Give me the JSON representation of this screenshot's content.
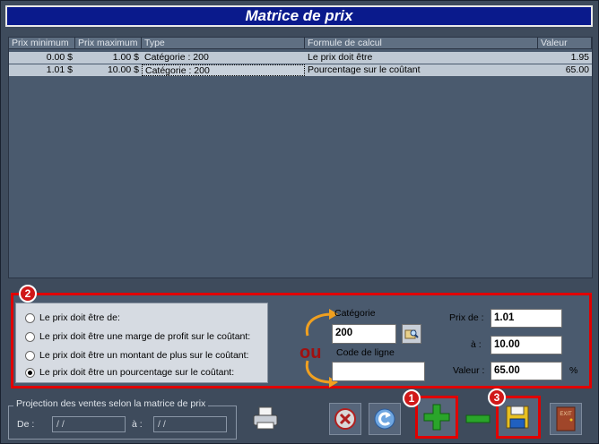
{
  "window": {
    "title": "Matrice de prix"
  },
  "table": {
    "columns": [
      "Prix minimum",
      "Prix maximum",
      "Type",
      "Formule de calcul",
      "Valeur"
    ],
    "rows": [
      {
        "min": "0.00 $",
        "max": "1.00 $",
        "type": "Catégorie : 200",
        "formule": "Le prix doit être",
        "valeur": "1.95"
      },
      {
        "min": "1.01 $",
        "max": "10.00 $",
        "type": "Catégorie : 200",
        "formule": "Pourcentage sur le coûtant",
        "valeur": "65.00"
      }
    ]
  },
  "annotations": {
    "badge1": "1",
    "badge2": "2",
    "badge3": "3",
    "or_label": "ou"
  },
  "form": {
    "options": [
      {
        "label": "Le prix doit être de:",
        "selected": false
      },
      {
        "label": "Le prix doit être une marge de profit sur le coûtant:",
        "selected": false
      },
      {
        "label": "Le prix doit être un montant de plus sur le coûtant:",
        "selected": false
      },
      {
        "label": "Le prix doit être un pourcentage sur le coûtant:",
        "selected": true
      }
    ],
    "categorie_label": "Catégorie",
    "categorie_value": "200",
    "code_ligne_label": "Code de ligne",
    "code_ligne_value": "",
    "prix_de_label": "Prix de :",
    "prix_de_value": "1.01",
    "a_label": "à :",
    "a_value": "10.00",
    "valeur_label": "Valeur :",
    "valeur_value": "65.00",
    "percent_sign": "%"
  },
  "projection": {
    "title": "Projection des ventes selon la matrice de prix",
    "de_label": "De :",
    "de_value": "/ /",
    "a_label": "à :",
    "a_value": "/ /"
  },
  "toolbar": {
    "icons": [
      "printer-icon",
      "cancel-icon",
      "undo-icon",
      "add-icon",
      "remove-icon",
      "save-icon",
      "exit-icon"
    ],
    "exit_label": "EXIT"
  },
  "colors": {
    "accent_red": "#e00000",
    "title_blue": "#0a1a8c",
    "add_green": "#2aa52a"
  }
}
